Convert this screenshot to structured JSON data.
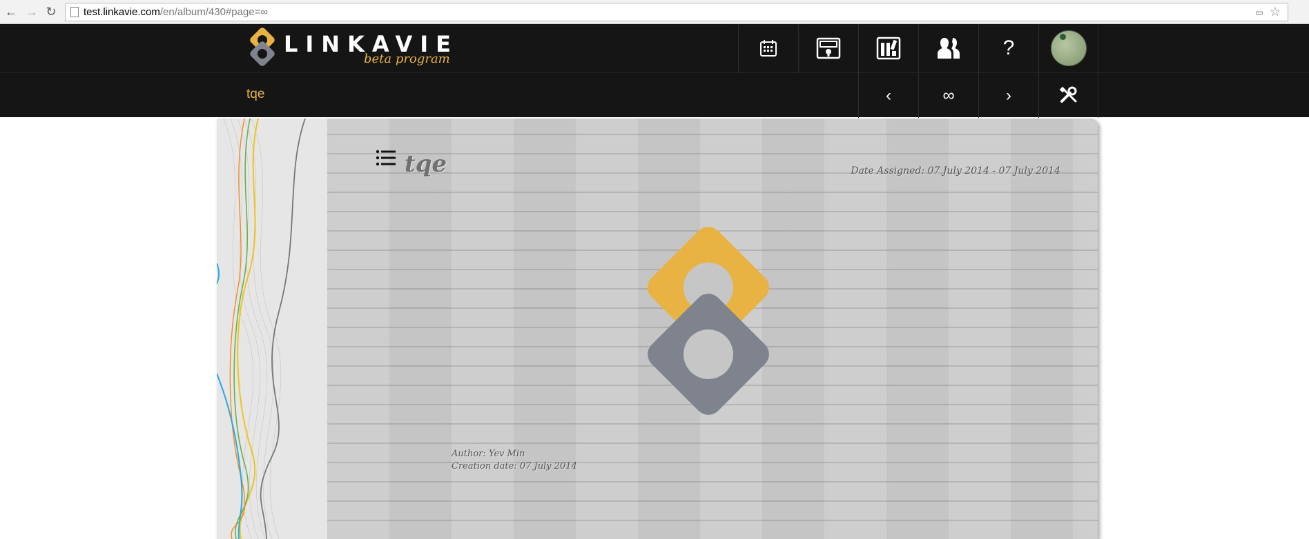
{
  "browser": {
    "url_host": "test.linkavie.com",
    "url_path": "/en/album/430#page=∞"
  },
  "header": {
    "logo_text": "LINKAVIE",
    "logo_sub": "beta program",
    "nav_icons": [
      "calendar-icon",
      "album-icon",
      "library-icon",
      "friends-icon",
      "help-icon"
    ],
    "help_label": "?"
  },
  "subheader": {
    "album_name": "tqe",
    "prev_label": "‹",
    "page_label": "∞",
    "next_label": "›"
  },
  "album": {
    "title": "tqe",
    "date_assigned": "Date Assigned: 07 July 2014 - 07 July 2014",
    "author": "Author: Yev Min",
    "creation_date": "Creation date: 07 July 2014"
  },
  "colors": {
    "brand_yellow": "#e8b343",
    "brand_gray": "#7e838e",
    "header_bg": "#151515"
  }
}
